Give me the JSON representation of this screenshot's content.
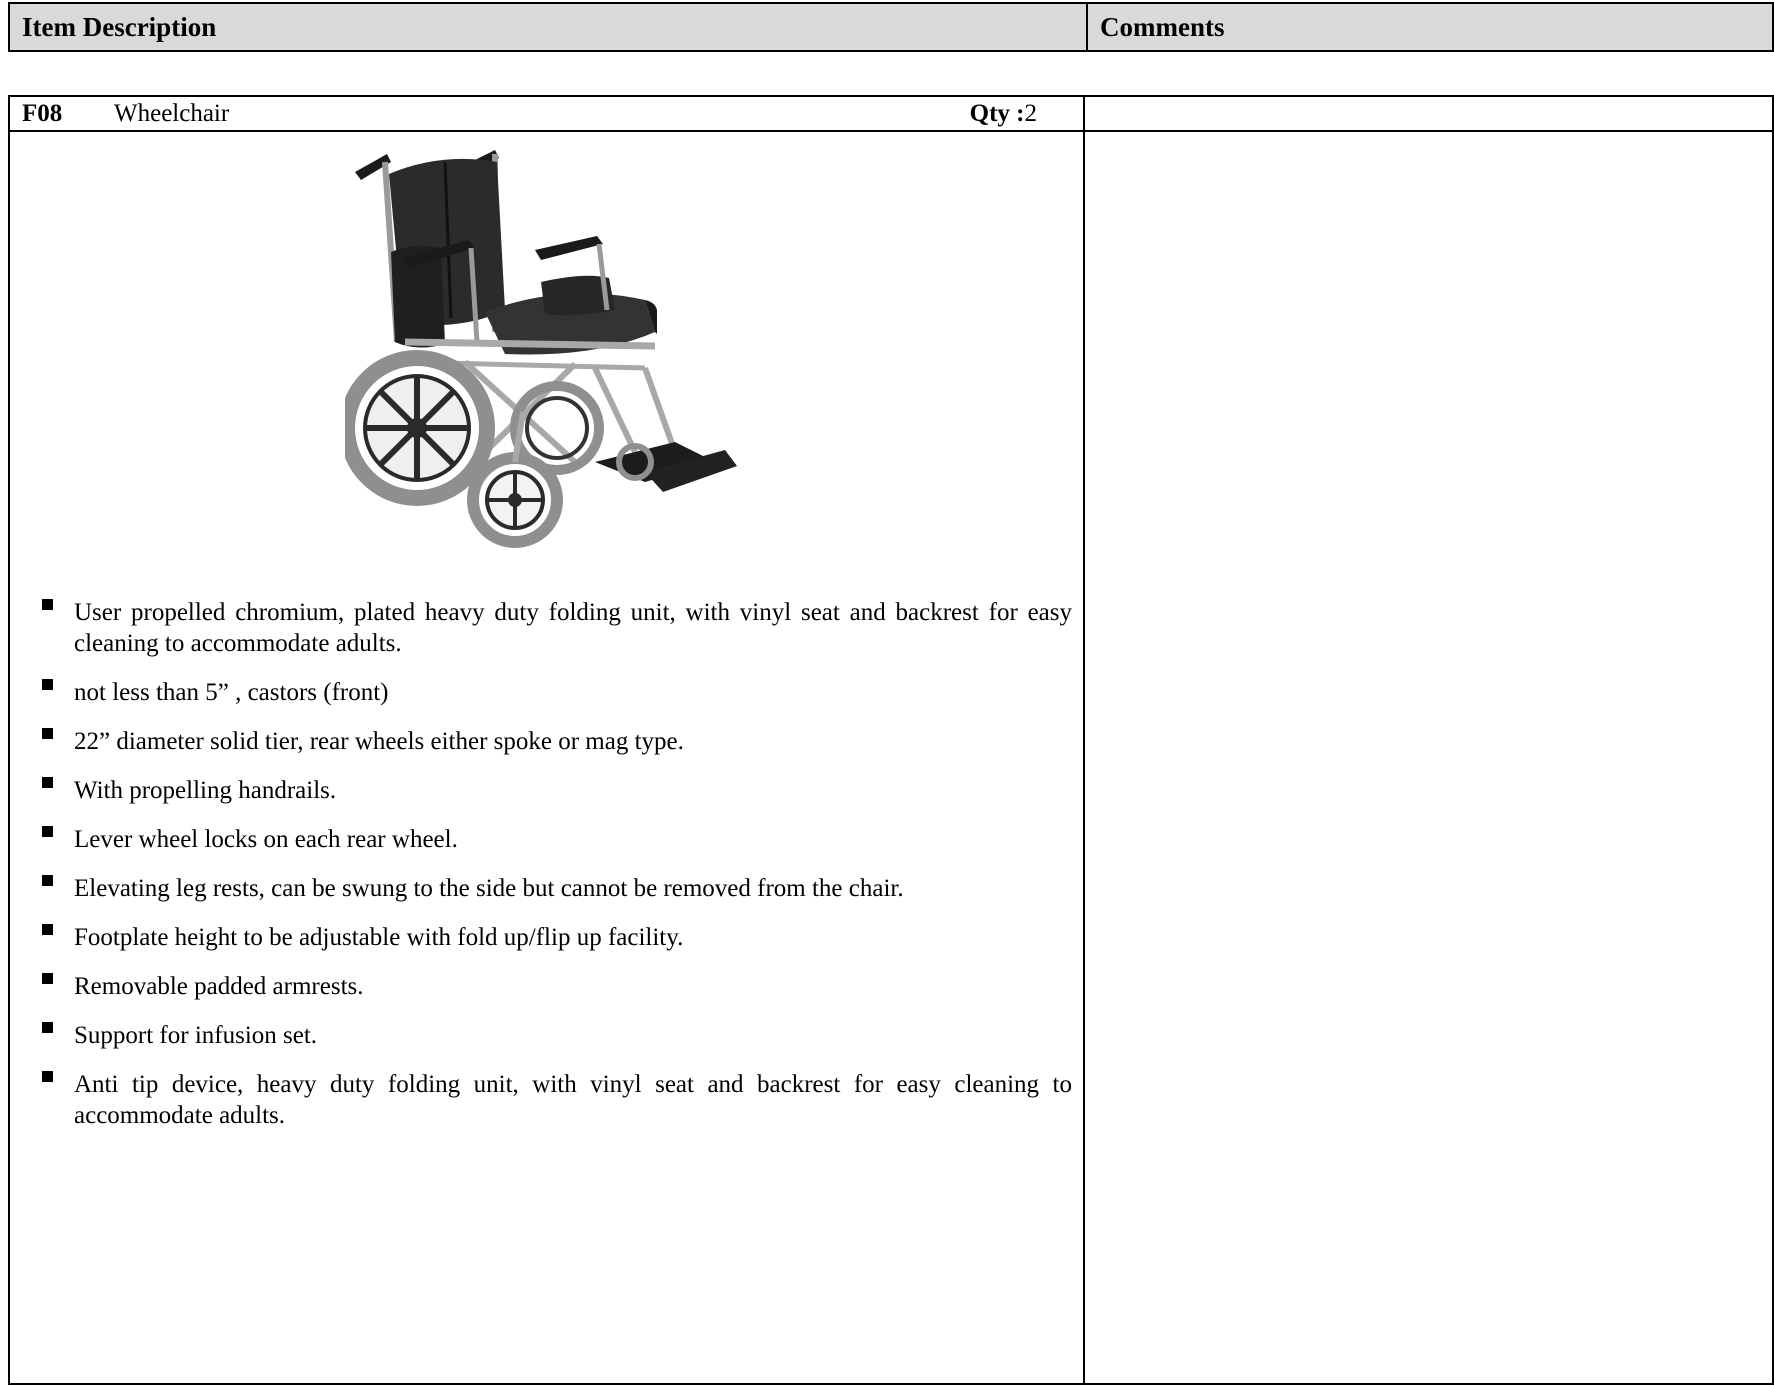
{
  "header": {
    "item_description": "Item Description",
    "comments": "Comments"
  },
  "item": {
    "code": "F08",
    "name": "Wheelchair",
    "qty_label": "Qty :",
    "qty_value": "2",
    "image_icon": "wheelchair-illustration",
    "specs": [
      "User propelled chromium, plated heavy duty folding unit, with vinyl seat and backrest for easy cleaning to accommodate adults.",
      "not less than 5” , castors (front)",
      "22” diameter solid tier, rear wheels either spoke or mag type.",
      "With propelling handrails.",
      "Lever wheel locks on each rear wheel.",
      "Elevating leg rests, can be swung to the side but cannot be removed from the chair.",
      "Footplate height to be adjustable with fold up/flip up facility.",
      "Removable padded armrests.",
      "Support for infusion set.",
      "Anti tip device, heavy duty folding unit, with vinyl seat and backrest for easy cleaning to accommodate adults."
    ],
    "comments": ""
  },
  "colors": {
    "header_bg": "#d9d9d9",
    "border": "#000000"
  }
}
